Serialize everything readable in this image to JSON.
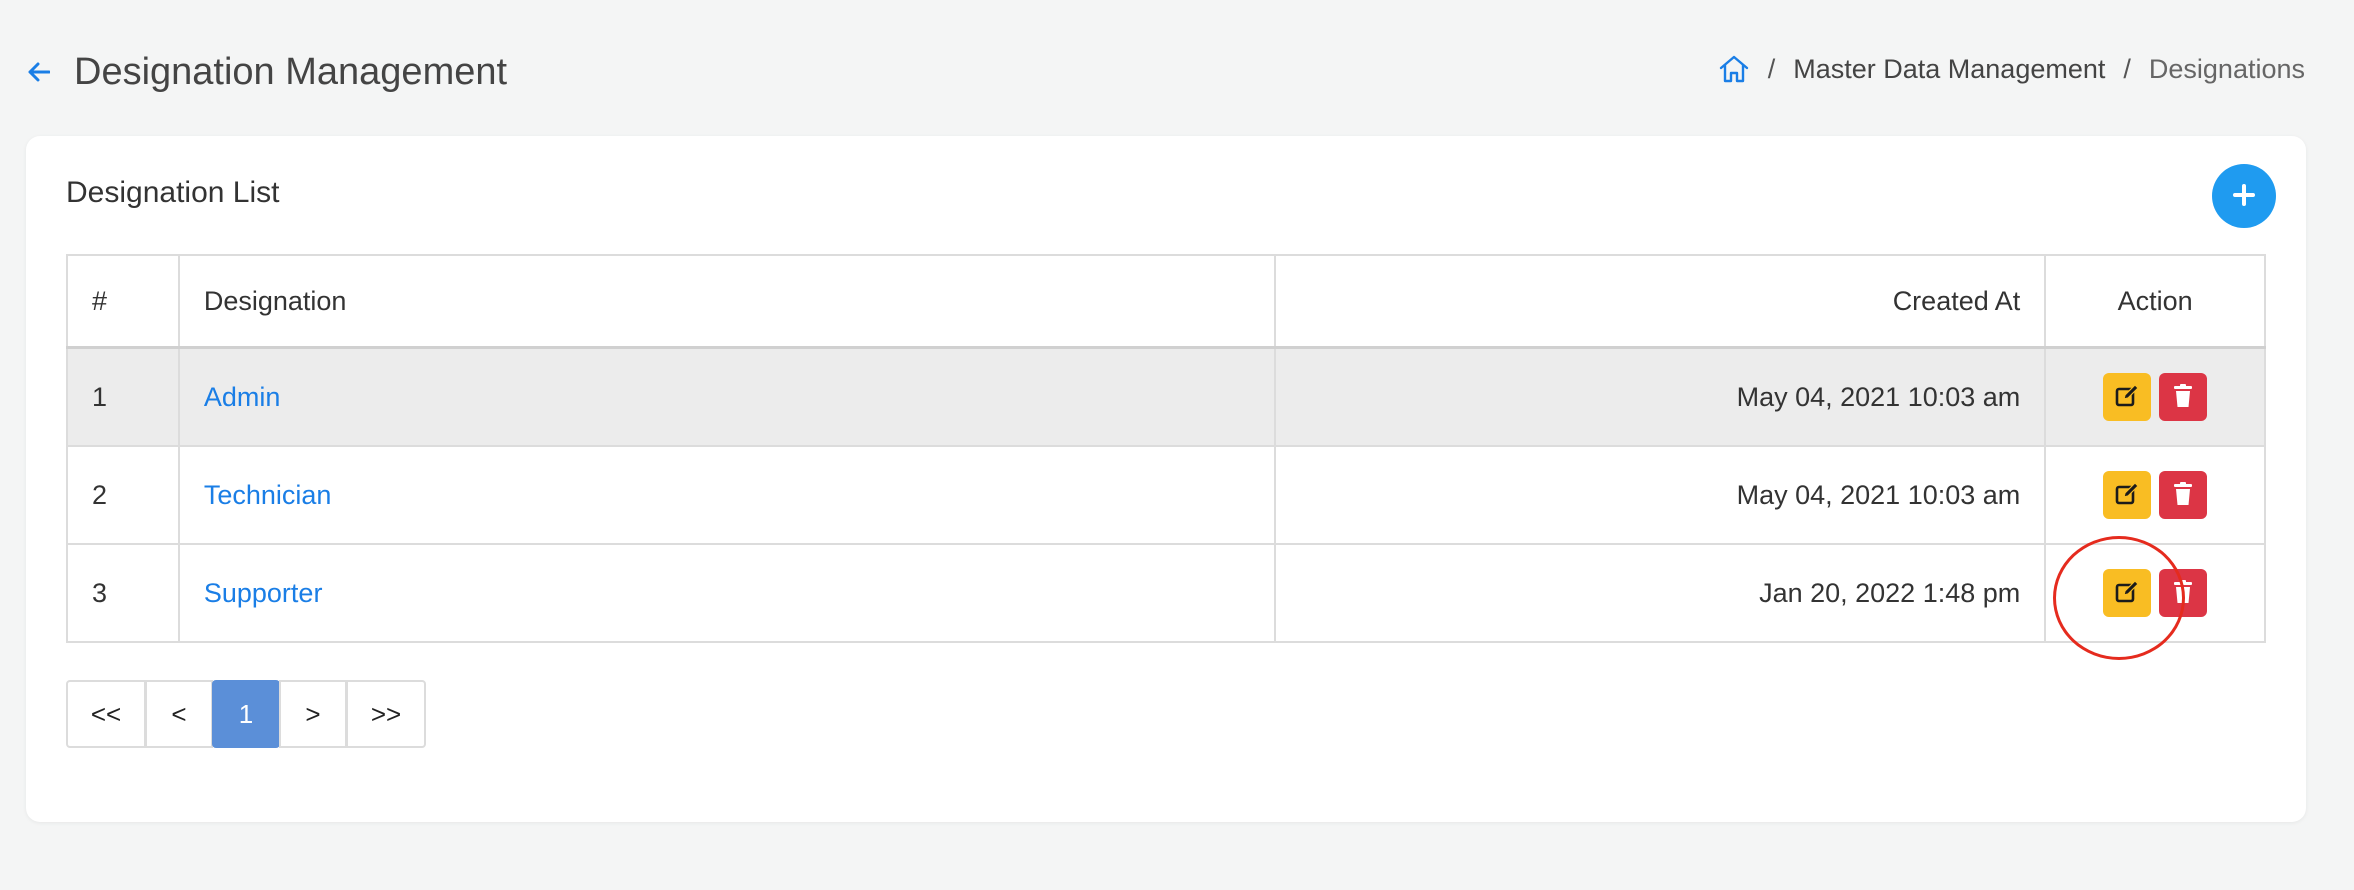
{
  "header": {
    "title": "Designation Management",
    "back_icon": "arrow-left-icon"
  },
  "breadcrumb": {
    "home_icon": "home-icon",
    "separator": "/",
    "items": [
      "Master Data Management",
      "Designations"
    ]
  },
  "card": {
    "title": "Designation List",
    "add_icon": "plus-icon"
  },
  "table": {
    "columns": [
      "#",
      "Designation",
      "Created At",
      "Action"
    ],
    "rows": [
      {
        "num": "1",
        "name": "Admin",
        "created_at": "May 04, 2021 10:03 am"
      },
      {
        "num": "2",
        "name": "Technician",
        "created_at": "May 04, 2021 10:03 am"
      },
      {
        "num": "3",
        "name": "Supporter",
        "created_at": "Jan 20, 2022 1:48 pm"
      }
    ]
  },
  "pagination": {
    "first": "<<",
    "prev": "<",
    "current": "1",
    "next": ">",
    "last": ">>"
  },
  "colors": {
    "accent": "#1f9bf0",
    "link": "#1a7ee6",
    "edit": "#f9bd23",
    "delete": "#dc3545",
    "pagination_active": "#5b8fd8",
    "highlight": "#e52b1e"
  }
}
